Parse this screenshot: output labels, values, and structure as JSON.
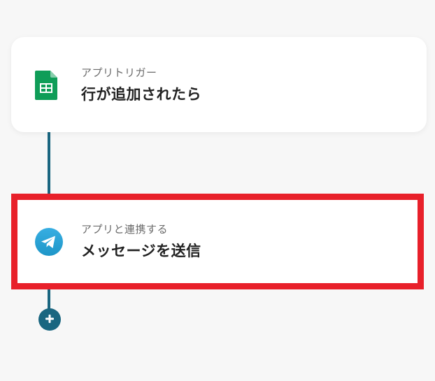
{
  "flow": {
    "trigger": {
      "subtitle": "アプリトリガー",
      "title": "行が追加されたら",
      "icon": "google-sheets-icon",
      "icon_color": "#0f9d58"
    },
    "action": {
      "subtitle": "アプリと連携する",
      "title": "メッセージを送信",
      "icon": "telegram-icon",
      "icon_color": "#2aa3e0"
    },
    "add_button": {
      "icon": "plus-icon",
      "color": "#1a6680"
    }
  },
  "colors": {
    "background": "#f7f7f7",
    "connector": "#1a6680",
    "highlight_border": "#e8202a",
    "card": "#ffffff"
  }
}
